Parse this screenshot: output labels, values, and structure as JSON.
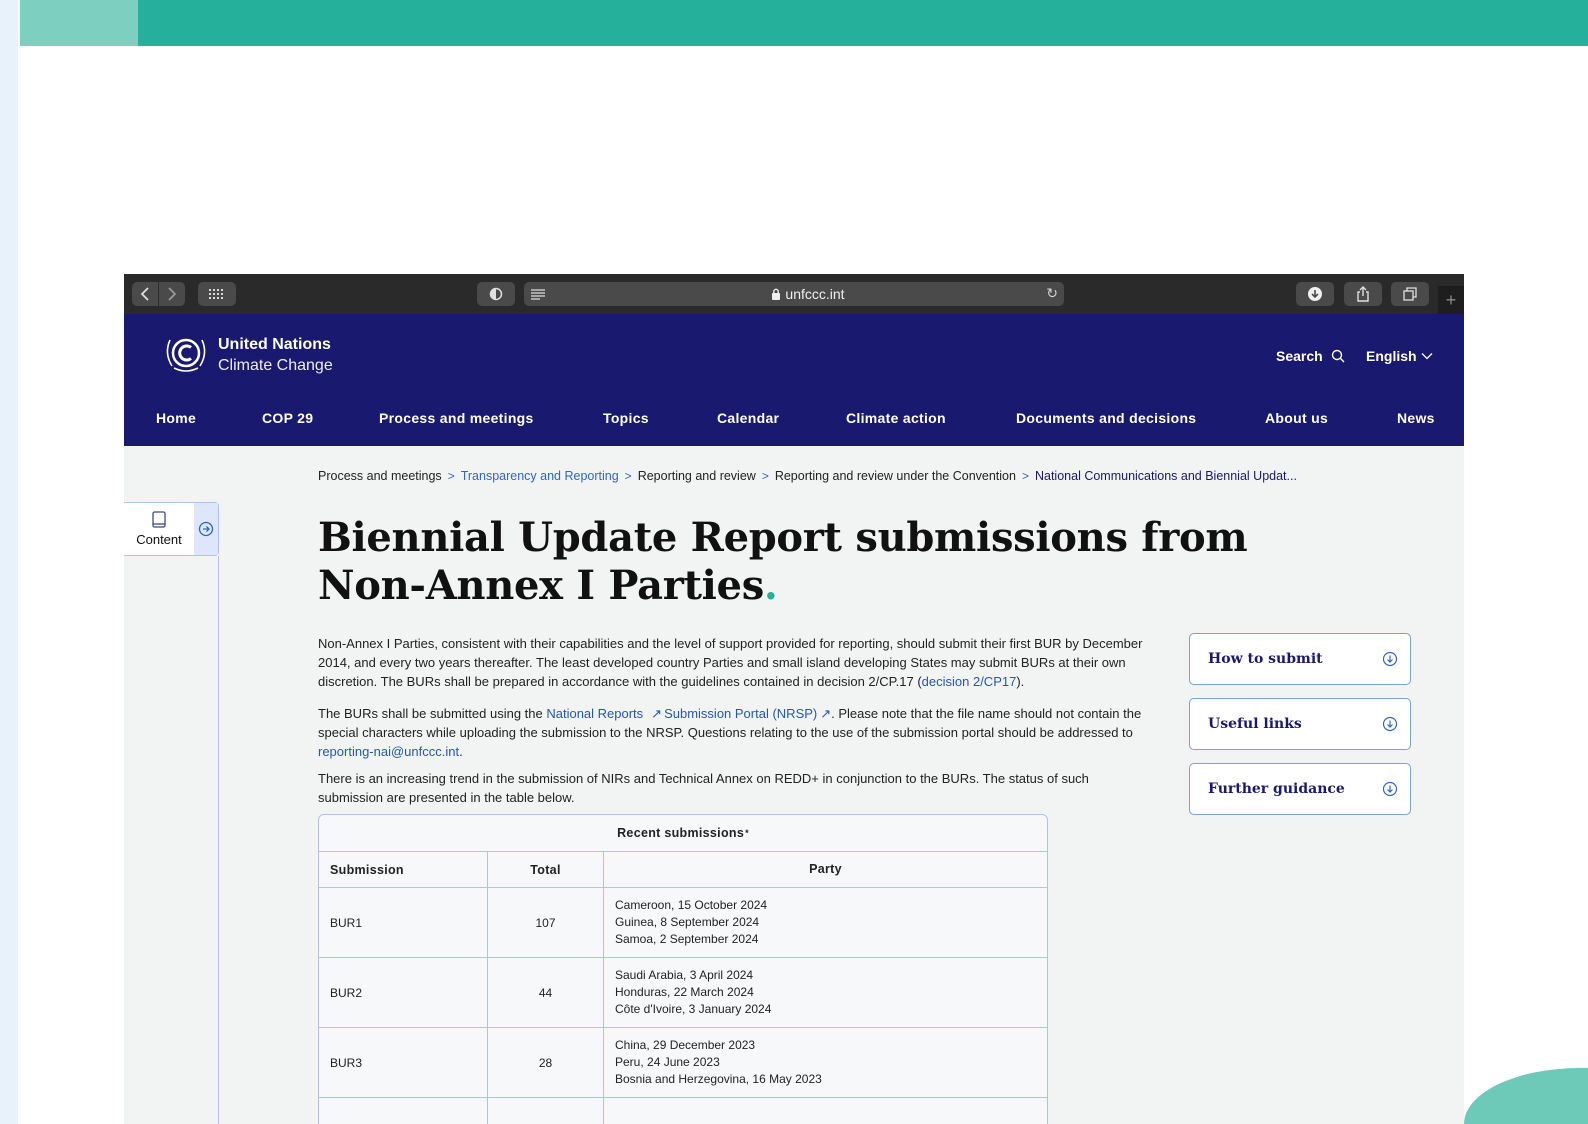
{
  "browser": {
    "url": "unfccc.int"
  },
  "site": {
    "logo_line1": "United Nations",
    "logo_line2": "Climate Change",
    "search_label": "Search",
    "language_label": "English",
    "nav": [
      "Home",
      "COP 29",
      "Process and meetings",
      "Topics",
      "Calendar",
      "Climate action",
      "Documents and decisions",
      "About us",
      "News"
    ]
  },
  "sidebar": {
    "content_label": "Content"
  },
  "breadcrumb": {
    "items": [
      "Process and meetings",
      "Transparency and Reporting",
      "Reporting and review",
      "Reporting and review under the Convention",
      "National Communications and Biennial Updat..."
    ]
  },
  "page": {
    "title": "Biennial Update Report submissions from Non-Annex I Parties",
    "title_dot": ".",
    "p1_text": "Non-Annex I Parties, consistent with their capabilities and the level of support provided for reporting, should submit their first BUR by December 2014, and every two years thereafter. The least developed country Parties and small island developing States may submit BURs at their own discretion. The BURs shall be prepared in accordance with the guidelines contained in decision 2/CP.17 (",
    "p1_link": "decision 2/CP17",
    "p1_end": ").",
    "p2_start": "The BURs shall be submitted using the ",
    "p2_link1": "National Reports",
    "p2_link2": "Submission Portal (NRSP)",
    "p2_mid": ". Please note that the file name should not contain the special characters while uploading the submission to the NRSP. Questions relating to the use of the submission portal should be addressed to ",
    "p2_email": "reporting-nai@unfccc.int",
    "p2_end": ".",
    "p3_text": "There is an increasing trend in the submission of NIRs and Technical Annex on REDD+ in conjunction to the BURs. The status of such submission are presented in the table below."
  },
  "side_buttons": [
    "How to submit",
    "Useful links",
    "Further guidance"
  ],
  "table": {
    "caption": "Recent submissions",
    "caption_mark": "*",
    "headers": [
      "Submission",
      "Total",
      "Party"
    ],
    "rows": [
      {
        "submission": "BUR1",
        "total": "107",
        "parties": [
          "Cameroon, 15 October 2024",
          "Guinea, 8 September 2024",
          "Samoa, 2 September 2024"
        ]
      },
      {
        "submission": "BUR2",
        "total": "44",
        "parties": [
          "Saudi Arabia, 3 April 2024",
          "Honduras, 22 March 2024",
          "Côte d'Ivoire, 3 January 2024"
        ]
      },
      {
        "submission": "BUR3",
        "total": "28",
        "parties": [
          "China, 29 December 2023",
          "Peru, 24 June 2023",
          "Bosnia and Herzegovina, 16 May 2023"
        ]
      }
    ]
  },
  "colors": {
    "header_navy": "#191970",
    "accent_teal": "#24b09b",
    "link_blue": "#2457b8"
  }
}
